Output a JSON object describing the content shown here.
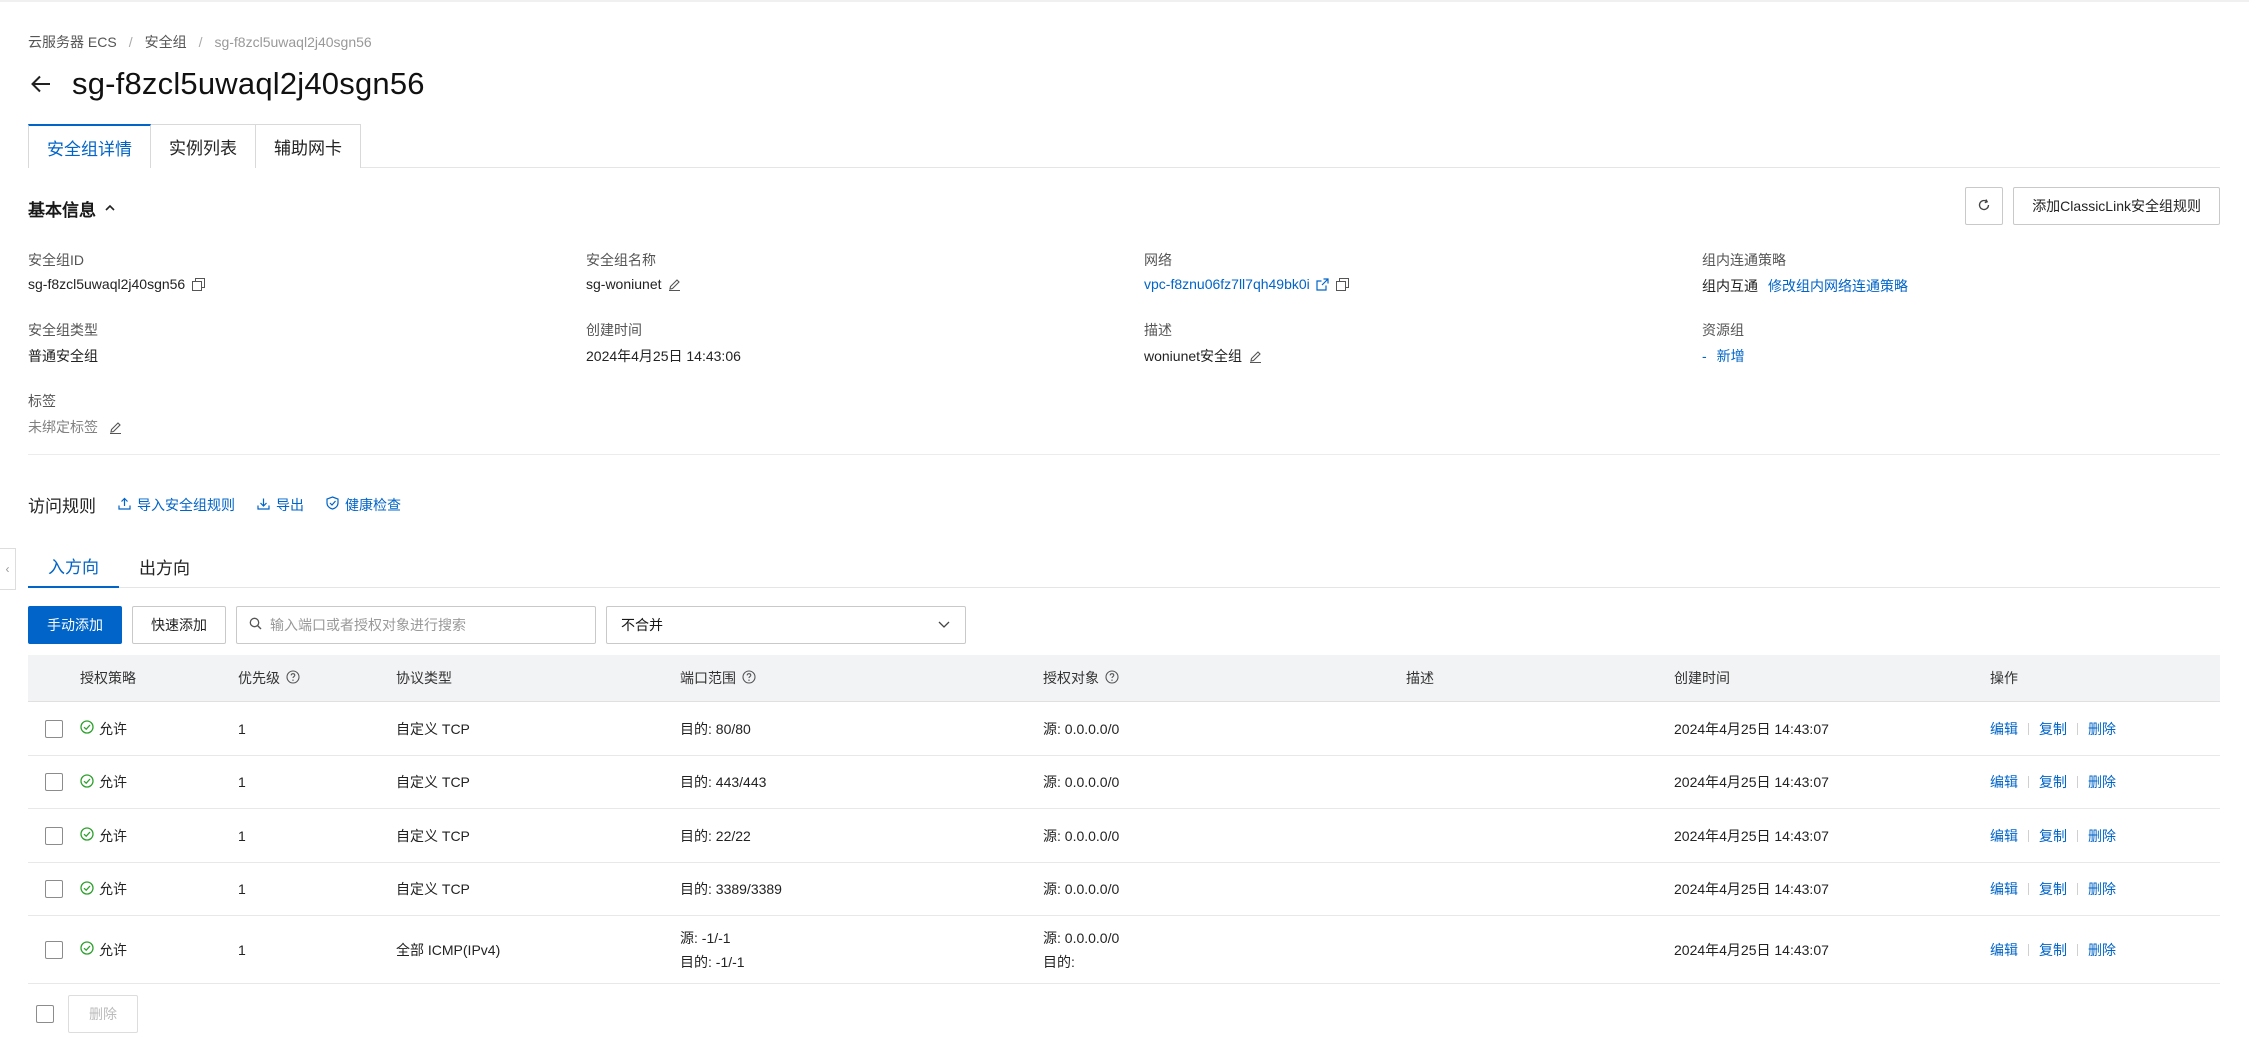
{
  "breadcrumb": {
    "items": [
      "云服务器 ECS",
      "安全组",
      "sg-f8zcl5uwaql2j40sgn56"
    ]
  },
  "page_title": "sg-f8zcl5uwaql2j40sgn56",
  "tabs": [
    "安全组详情",
    "实例列表",
    "辅助网卡"
  ],
  "basic_info": {
    "title": "基本信息",
    "add_classiclink_label": "添加ClassicLink安全组规则",
    "fields": {
      "sg_id": {
        "label": "安全组ID",
        "value": "sg-f8zcl5uwaql2j40sgn56"
      },
      "sg_name": {
        "label": "安全组名称",
        "value": "sg-woniunet"
      },
      "network": {
        "label": "网络",
        "value": "vpc-f8znu06fz7ll7qh49bk0i"
      },
      "intra_policy": {
        "label": "组内连通策略",
        "value": "组内互通",
        "link": "修改组内网络连通策略"
      },
      "sg_type": {
        "label": "安全组类型",
        "value": "普通安全组"
      },
      "created": {
        "label": "创建时间",
        "value": "2024年4月25日 14:43:06"
      },
      "description": {
        "label": "描述",
        "value": "woniunet安全组"
      },
      "resource_group": {
        "label": "资源组",
        "value": "-",
        "link": "新增"
      },
      "tags": {
        "label": "标签",
        "value": "未绑定标签"
      }
    }
  },
  "rules": {
    "title": "访问规则",
    "import_label": "导入安全组规则",
    "export_label": "导出",
    "health_label": "健康检查",
    "direction_tabs": [
      "入方向",
      "出方向"
    ],
    "manual_add_label": "手动添加",
    "quick_add_label": "快速添加",
    "search_placeholder": "输入端口或者授权对象进行搜索",
    "merge_select_value": "不合并",
    "columns": [
      "授权策略",
      "优先级",
      "协议类型",
      "端口范围",
      "授权对象",
      "描述",
      "创建时间",
      "操作"
    ],
    "rows": [
      {
        "policy": "允许",
        "priority": "1",
        "protocol": "自定义 TCP",
        "port": "目的: 80/80",
        "auth": "源: 0.0.0.0/0",
        "desc": "",
        "time": "2024年4月25日 14:43:07"
      },
      {
        "policy": "允许",
        "priority": "1",
        "protocol": "自定义 TCP",
        "port": "目的: 443/443",
        "auth": "源: 0.0.0.0/0",
        "desc": "",
        "time": "2024年4月25日 14:43:07"
      },
      {
        "policy": "允许",
        "priority": "1",
        "protocol": "自定义 TCP",
        "port": "目的: 22/22",
        "auth": "源: 0.0.0.0/0",
        "desc": "",
        "time": "2024年4月25日 14:43:07"
      },
      {
        "policy": "允许",
        "priority": "1",
        "protocol": "自定义 TCP",
        "port": "目的: 3389/3389",
        "auth": "源: 0.0.0.0/0",
        "desc": "",
        "time": "2024年4月25日 14:43:07"
      },
      {
        "policy": "允许",
        "priority": "1",
        "protocol": "全部 ICMP(IPv4)",
        "port": "源: -1/-1",
        "port2": "目的: -1/-1",
        "auth": "源: 0.0.0.0/0",
        "auth2": "目的:",
        "desc": "",
        "time": "2024年4月25日 14:43:07"
      }
    ],
    "row_ops": {
      "edit": "编辑",
      "copy": "复制",
      "delete": "删除"
    },
    "bulk_delete_label": "删除"
  },
  "colors": {
    "accent": "#0064c8",
    "success": "#2ca02c"
  }
}
